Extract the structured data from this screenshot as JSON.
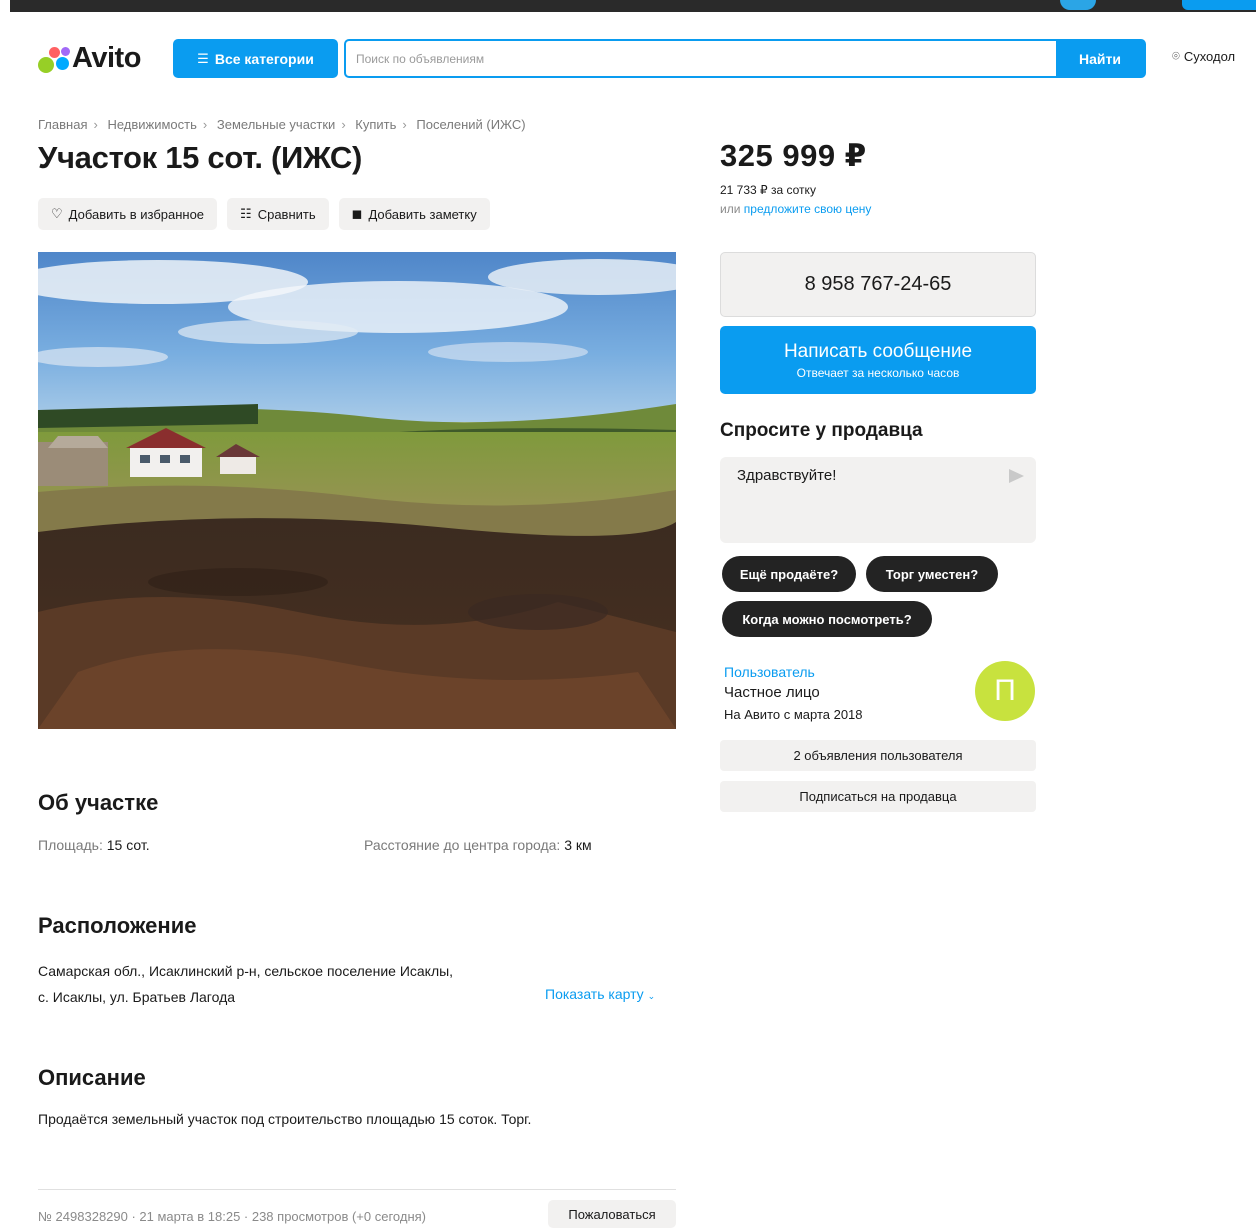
{
  "header": {
    "logo": "Avito",
    "categories_label": "Все категории",
    "categories_icon": "list-search-icon",
    "search_placeholder": "Поиск по объявлениям",
    "search_button": "Найти",
    "location": "Суходол",
    "location_icon": "location-pin-icon"
  },
  "breadcrumb": [
    "Главная",
    "Недвижимость",
    "Земельные участки",
    "Купить",
    "Поселений (ИЖС)"
  ],
  "listing": {
    "title": "Участок 15 сот. (ИЖС)",
    "actions": {
      "favorite": "Добавить в избранное",
      "compare": "Сравнить",
      "note": "Добавить заметку"
    }
  },
  "about": {
    "heading": "Об участке",
    "area_label": "Площадь:",
    "area_value": "15 сот.",
    "distance_label": "Расстояние до центра города:",
    "distance_value": "3 км"
  },
  "location_section": {
    "heading": "Расположение",
    "address_line1": "Самарская обл., Исаклинский р-н, сельское поселение Исаклы,",
    "address_line2": "с. Исаклы, ул. Братьев Лагода",
    "map_link": "Показать карту"
  },
  "description": {
    "heading": "Описание",
    "text": "Продаётся земельный участок под строительство площадью 15 соток. Торг."
  },
  "footer": {
    "meta": "№ 2498328290 · 21 марта в 18:25 · 238 просмотров (+0 сегодня)",
    "report": "Пожаловаться"
  },
  "price": {
    "value": "325 999 ₽",
    "per_unit": "21 733 ₽ за сотку",
    "offer_prefix": "или",
    "offer_link": "предложите свою цену"
  },
  "contact": {
    "phone": "8 958 767-24-65",
    "message_title": "Написать сообщение",
    "message_subtitle": "Отвечает за несколько часов"
  },
  "ask": {
    "heading": "Спросите у продавца",
    "input_value": "Здравствуйте!",
    "chips": [
      "Ещё продаёте?",
      "Торг уместен?",
      "Когда можно посмотреть?"
    ]
  },
  "seller": {
    "name": "Пользователь",
    "type": "Частное лицо",
    "since": "На Авито с марта 2018",
    "avatar_letter": "П",
    "listings_button": "2 объявления пользователя",
    "subscribe_button": "Подписаться на продавца"
  },
  "colors": {
    "accent": "#0a9cf0",
    "chip_bg": "#232323",
    "avatar_bg": "#c8e23e"
  }
}
